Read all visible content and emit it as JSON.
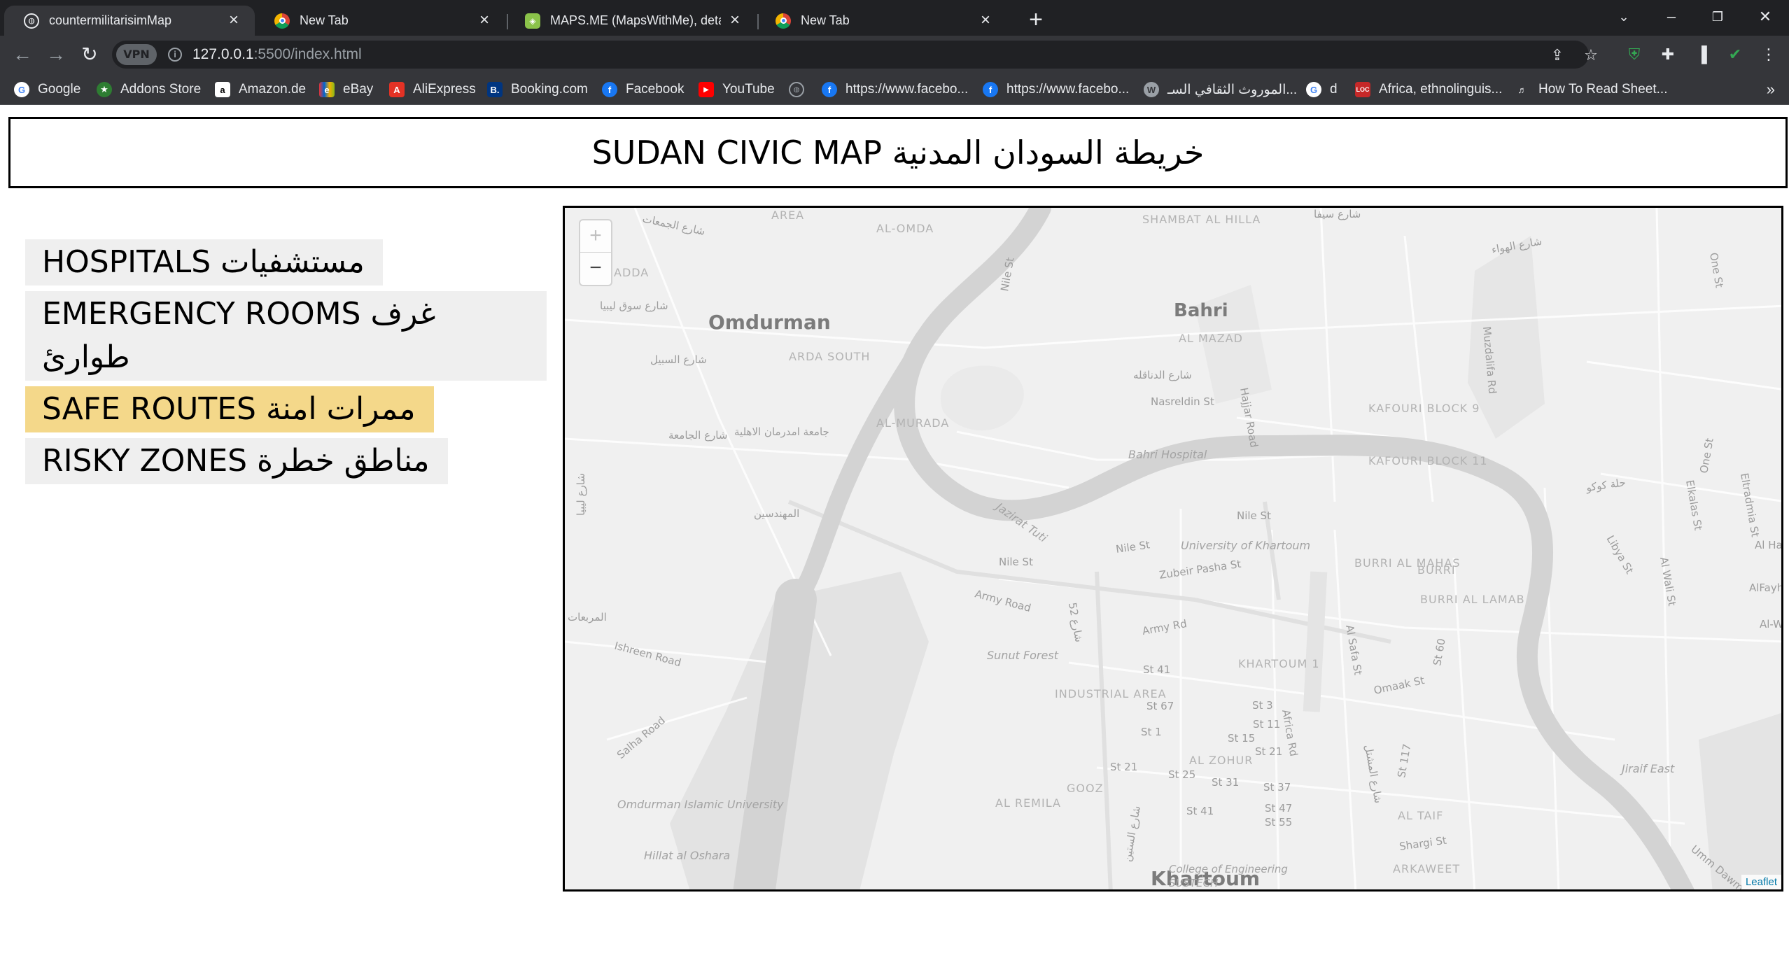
{
  "browser": {
    "tabs": [
      {
        "title": "countermilitarisimMap",
        "icon": "globe-icon"
      },
      {
        "title": "New Tab",
        "icon": "chrome-icon"
      },
      {
        "title": "MAPS.ME (MapsWithMe), detailed",
        "icon": "mapsme-icon"
      },
      {
        "title": "New Tab",
        "icon": "chrome-icon"
      }
    ],
    "url_host": "127.0.0.1",
    "url_rest": ":5500/index.html",
    "vpn_label": "VPN",
    "bookmarks": [
      {
        "label": "Google",
        "icon": "google-icon",
        "color": "#ffffff"
      },
      {
        "label": "Addons Store",
        "icon": "addons-icon",
        "color": "#2e7d32"
      },
      {
        "label": "Amazon.de",
        "icon": "amazon-icon",
        "color": "#ffffff"
      },
      {
        "label": "eBay",
        "icon": "ebay-icon",
        "color": "#e53238"
      },
      {
        "label": "AliExpress",
        "icon": "aliexpress-icon",
        "color": "#e43225"
      },
      {
        "label": "Booking.com",
        "icon": "booking-icon",
        "color": "#003580"
      },
      {
        "label": "Facebook",
        "icon": "facebook-icon",
        "color": "#1877f2"
      },
      {
        "label": "YouTube",
        "icon": "youtube-icon",
        "color": "#ff0000"
      },
      {
        "label": "",
        "icon": "globe-icon",
        "color": "#9aa0a6"
      },
      {
        "label": "https://www.facebo...",
        "icon": "facebook-icon",
        "color": "#1877f2"
      },
      {
        "label": "https://www.facebo...",
        "icon": "facebook-icon",
        "color": "#1877f2"
      },
      {
        "label": "الموروث الثقافي السـ...",
        "icon": "wordpress-icon",
        "color": "#9aa0a6"
      },
      {
        "label": "d",
        "icon": "google-icon",
        "color": "#ffffff"
      },
      {
        "label": "Africa, ethnolinguis...",
        "icon": "loc-icon",
        "color": "#c62828"
      },
      {
        "label": "How To Read Sheet...",
        "icon": "music-icon",
        "color": "#9aa0a6"
      }
    ]
  },
  "page": {
    "title": "SUDAN CIVIC MAP خريطة السودان المدنية",
    "menu": [
      {
        "label": "HOSPITALS مستشفيات",
        "selected": false
      },
      {
        "label": "EMERGENCY ROOMS غرف طوارئ",
        "selected": false
      },
      {
        "label": "SAFE ROUTES ممرات امنة",
        "selected": true
      },
      {
        "label": "RISKY ZONES مناطق خطرة",
        "selected": false
      }
    ],
    "map": {
      "zoom_in": "+",
      "zoom_out": "−",
      "attribution": "Leaflet",
      "cities": [
        "Omdurman",
        "Bahri",
        "Khartoum"
      ],
      "places": [
        "AREA",
        "AL-OMDA",
        "SHAMBAT AL HILLA",
        "AL MAZAD",
        "ARDA SOUTH",
        "AL-MURADA",
        "KAFOURI BLOCK 9",
        "KAFOURI BLOCK 11",
        "Bahri Hospital",
        "Nasreldin St",
        "Jazirat Tuti",
        "University of Khartoum",
        "BURRI AL MAHAS",
        "BURRI",
        "BURRI AL LAMAB",
        "Sunut Forest",
        "KHARTOUM 1",
        "INDUSTRIAL AREA",
        "AL ZOHUR",
        "AL REMILA",
        "GOOZ",
        "AL TAIF",
        "ARKAWEET",
        "Jiraif East",
        "Omdurman Islamic University",
        "Hillat al Oshara",
        "College of Engineering",
        "SUSTECH",
        "ADDA"
      ],
      "streets": [
        "Nile St",
        "Nile St",
        "Nile St",
        "Nile St",
        "Army Road",
        "Army Rd",
        "Zubeir Pasha St",
        "Hajjar Road",
        "Africa Rd",
        "Al Safa St",
        "Omaak St",
        "Shargi St",
        "St 60",
        "St 117",
        "St 41",
        "St 67",
        "St 1",
        "St 15",
        "St 21",
        "St 3",
        "St 11",
        "St 21",
        "St 25",
        "St 31",
        "St 37",
        "St 41",
        "St 47",
        "St 55",
        "Ishreen Road",
        "Salha Road",
        "Muzdalifa Rd",
        "Libya St",
        "Al Wali St",
        "Elkalas St",
        "One St",
        "One St",
        "Eltradmia St",
        "Al Haj Yo",
        "AlFayha",
        "Al-W",
        "Umm Dawm",
        "شارع الدناقله",
        "شارع سيفا",
        "شارع الهواء",
        "شارع سوق ليبيا",
        "شارع السبيل",
        "شارع الجامعة",
        "جامعة امدرمان الاهلية",
        "المهندسين",
        "المربعات",
        "شارع الجمعات",
        "حلة كوكو",
        "شارع المشتل",
        "شارع ليبيا",
        "شارع 52",
        "شارع الستين"
      ]
    }
  }
}
